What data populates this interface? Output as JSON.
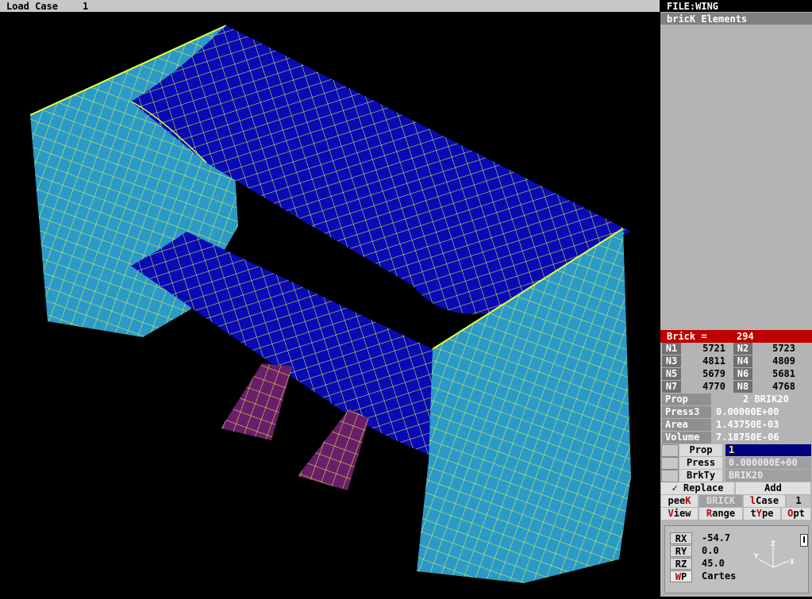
{
  "top_bar": {
    "label": "Load Case",
    "value": "1"
  },
  "file_title": "FILE:WING",
  "panel_title": "bricK Elements",
  "brick": {
    "label": "Brick =",
    "id": "294"
  },
  "nodes": [
    {
      "label": "N1",
      "value": "5721"
    },
    {
      "label": "N2",
      "value": "5723"
    },
    {
      "label": "N3",
      "value": "4811"
    },
    {
      "label": "N4",
      "value": "4809"
    },
    {
      "label": "N5",
      "value": "5679"
    },
    {
      "label": "N6",
      "value": "5681"
    },
    {
      "label": "N7",
      "value": "4770"
    },
    {
      "label": "N8",
      "value": "4768"
    }
  ],
  "info": [
    {
      "label": "Prop",
      "value": "2 BRIK20"
    },
    {
      "label": "Press3",
      "value": "0.00000E+00"
    },
    {
      "label": "Area",
      "value": "1.43750E-03"
    },
    {
      "label": "Volume",
      "value": "7.18750E-06"
    }
  ],
  "fields": [
    {
      "label": "Prop",
      "value": "1"
    },
    {
      "label": "Press",
      "value": "0.000000E+00"
    },
    {
      "label": "BrkTy",
      "value": "BRIK20"
    }
  ],
  "buttons": {
    "replace": "✓ Replace",
    "add": "Add",
    "peek_a": "pee",
    "peek_b": "K",
    "brick_type": "BRICK",
    "lcase_a": "l",
    "lcase_b": "Case",
    "lcase_value": "1",
    "view_a": "V",
    "view_b": "iew",
    "range_a": "R",
    "range_b": "ange",
    "type_a": "t",
    "type_b": "Y",
    "type_c": "pe",
    "opt_a": "O",
    "opt_b": "pt"
  },
  "view": {
    "rx_label": "RX",
    "rx": "-54.7",
    "ry_label": "RY",
    "ry": "0.0",
    "rz_label": "RZ",
    "rz": "45.0",
    "wp_a": "W",
    "wp_b": "P",
    "coord": "Cartes",
    "axis_z": "Z",
    "axis_y": "Y",
    "axis_x": "X"
  },
  "colors": {
    "background": "#000000",
    "mesh_line": "#e6ff3c",
    "blue_surface": "#0a0ab4",
    "cyan_surface": "#2c9ac8",
    "purple_surface": "#6a1e6a",
    "selected": "#c00000"
  }
}
